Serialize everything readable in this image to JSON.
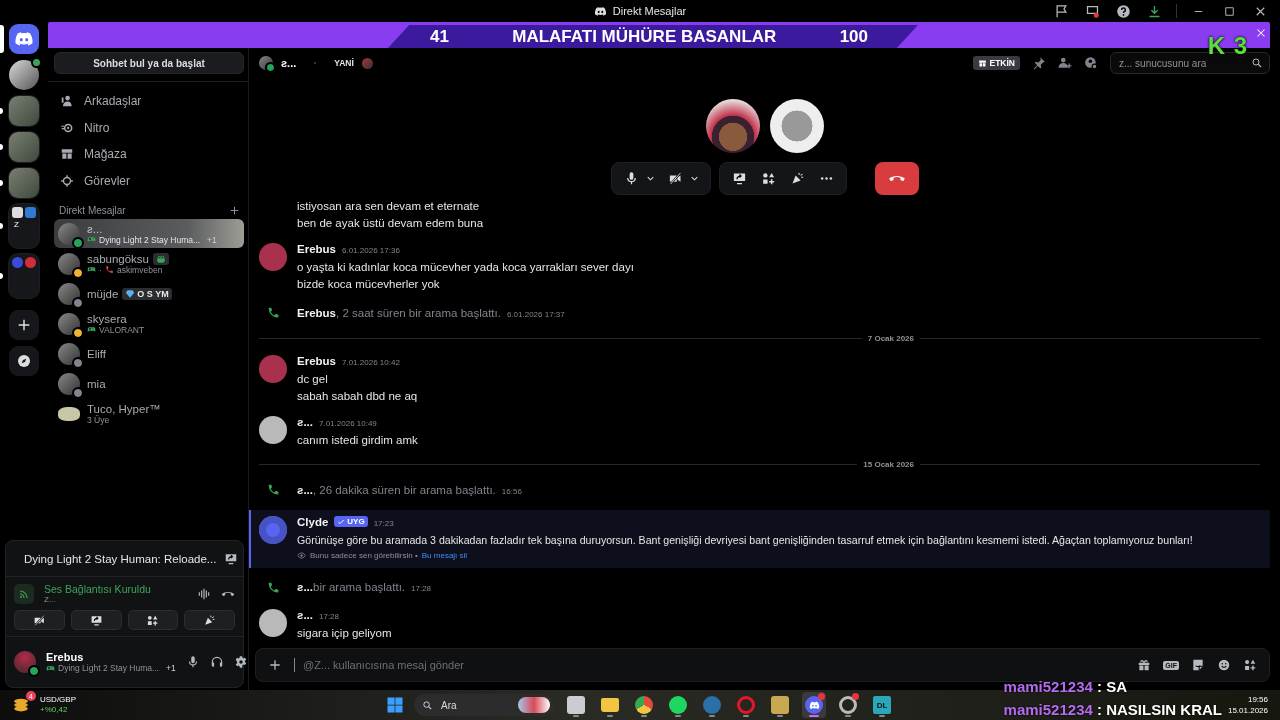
{
  "titlebar": {
    "title": "Direkt Mesajlar",
    "icons": [
      {
        "kind": "inbox"
      },
      {
        "kind": "screen_dot"
      },
      {
        "kind": "help"
      },
      {
        "kind": "download"
      }
    ]
  },
  "banner": {
    "overlay": {
      "left_score": "41",
      "title": "MALAFATI MÜHÜRE BASANLAR",
      "right_score": "100"
    },
    "logo": "K 3"
  },
  "server_rail": [
    {
      "kind": "home",
      "selected": true,
      "unread": false
    },
    {
      "kind": "voice_avatar",
      "selected": false,
      "unread": false
    },
    {
      "kind": "server",
      "selected": false,
      "unread": true
    },
    {
      "kind": "server",
      "selected": false,
      "unread": true
    },
    {
      "kind": "server",
      "selected": false,
      "unread": true
    },
    {
      "kind": "folder",
      "label": "Z",
      "selected": false,
      "unread": true
    },
    {
      "kind": "folder2",
      "selected": false,
      "unread": true
    },
    {
      "kind": "add",
      "selected": false,
      "unread": false
    },
    {
      "kind": "explore",
      "selected": false,
      "unread": false
    }
  ],
  "sidebar": {
    "search_button": "Sohbet bul ya da başlat",
    "nav": [
      {
        "kind": "friends",
        "label": "Arkadaşlar"
      },
      {
        "kind": "nitro",
        "label": "Nitro"
      },
      {
        "kind": "shop",
        "label": "Mağaza"
      },
      {
        "kind": "quests",
        "label": "Görevler"
      }
    ],
    "dm_header": "Direkt Mesajlar",
    "dms": [
      {
        "name": "ƨ...",
        "kind": "user",
        "color": "#23a55a",
        "selected": true,
        "activity": "Dying Light 2 Stay Huma...",
        "extra": "+1"
      },
      {
        "name": "sabungöksu",
        "kind": "user",
        "color": "#f0b232",
        "selected": false,
        "badge": {
          "kind": "frog"
        },
        "in_call": true,
        "separator": "·",
        "activity": "askimveben"
      },
      {
        "name": "müjde",
        "kind": "user",
        "color": "#80848e",
        "selected": false,
        "badge": {
          "kind": "gem",
          "text": "O S YM"
        }
      },
      {
        "name": "skysera",
        "kind": "user",
        "color": "#f0b232",
        "selected": false,
        "activity": "VALORANT"
      },
      {
        "name": "Eliff",
        "kind": "user",
        "color": "#80848e",
        "selected": false
      },
      {
        "name": "mia",
        "kind": "user",
        "color": "#80848e",
        "selected": false
      },
      {
        "name": "Tuco, Hyper™",
        "kind": "group",
        "selected": false,
        "subtitle": "3 Üye"
      }
    ]
  },
  "user_panel": {
    "activity_card": {
      "title": "Dying Light 2 Stay Human: Reloade..."
    },
    "voice": {
      "status": "Ses Bağlantısı Kuruldu",
      "channel": "Z...",
      "camera_off": true
    },
    "user": {
      "name": "Erebus",
      "color": "#23a55a",
      "activity": "Dying Light 2 Stay Huma...",
      "extra": "+1"
    }
  },
  "header": {
    "name": "ƨ...",
    "color": "#23a55a",
    "tag": "YANİ",
    "event_badge": "ETKİN",
    "search_placeholder": "z... sunucusunu ara"
  },
  "call": {
    "participants": [
      {
        "kind": "photo"
      },
      {
        "kind": "drawing"
      }
    ],
    "mic_muted": false,
    "camera_off": true
  },
  "messages": [
    {
      "kind": "continuation",
      "lines": [
        "istiyosan ara sen devam et eternate",
        "ben de ayak üstü devam edem buna"
      ]
    },
    {
      "kind": "message",
      "author": "Erebus",
      "color": "#a8324e",
      "time": "6.01.2026 17:36",
      "lines": [
        "o yaşta ki kadınlar koca mücevher yada koca yarrakları sever dayı",
        "bizde koca mücevherler yok"
      ]
    },
    {
      "kind": "call",
      "author": "Erebus",
      "text": ", 2 saat süren bir arama başlattı.",
      "time": "6.01.2026 17:37"
    },
    {
      "kind": "divider",
      "date": "7 Ocak 2026"
    },
    {
      "kind": "message",
      "author": "Erebus",
      "color": "#a8324e",
      "time": "7.01.2026 10:42",
      "lines": [
        "dc gel",
        "sabah sabah dbd ne aq"
      ]
    },
    {
      "kind": "message",
      "author": "ƨ...",
      "color": "#b9b9b9",
      "time": "7.01.2026 10:49",
      "lines": [
        "canım istedi girdim amk"
      ]
    },
    {
      "kind": "divider",
      "date": "15 Ocak 2026"
    },
    {
      "kind": "call",
      "author": "ƨ...",
      "text": ", 26 dakika süren bir arama başlattı.",
      "time": "16:56"
    },
    {
      "kind": "system",
      "author": "Clyde",
      "badge": "UYG",
      "time": "17:23",
      "text": "Görünüşe göre bu aramada 3 dakikadan fazladır tek başına duruyorsun. Bant genişliği devriyesi bant genişliğinden tasarruf etmek için bağlantını kesmemi istedi. Ağaçtan toplamıyoruz bunları!",
      "note": "Bunu sadece sen görebilirsin •",
      "link": "Bu mesajı sil"
    },
    {
      "kind": "call",
      "author": "ƨ...",
      "text": " bir arama başlattı.",
      "time": "17:28"
    },
    {
      "kind": "message",
      "author": "ƨ...",
      "color": "#b9b9b9",
      "time": "17:28",
      "lines": [
        "sigara içip geliyom"
      ]
    }
  ],
  "composer": {
    "placeholder": "@Z... kullanıcısına mesaj gönder",
    "gif": "GIF"
  },
  "taskbar": {
    "widget": {
      "badge": "4",
      "title": "USD/GBP",
      "change": "+%0,42"
    },
    "search_placeholder": "Ara",
    "apps": [
      {
        "kind": "taskview",
        "active": false,
        "notification": false
      },
      {
        "kind": "folder",
        "active": false,
        "notification": false
      },
      {
        "kind": "chrome",
        "active": false,
        "notification": false
      },
      {
        "kind": "spotify",
        "active": false,
        "notification": false
      },
      {
        "kind": "steam",
        "active": false,
        "notification": false
      },
      {
        "kind": "opera",
        "active": false,
        "notification": false
      },
      {
        "kind": "league",
        "active": false,
        "notification": false
      },
      {
        "kind": "discord",
        "active": true,
        "notification": true
      },
      {
        "kind": "obs",
        "active": false,
        "notification": true
      },
      {
        "kind": "dl",
        "label": "DL",
        "active": false,
        "notification": false
      }
    ],
    "time": "19:56",
    "date": "15.01.2026"
  },
  "stream_chat": [
    {
      "user": "mami521234",
      "text": ": SA"
    },
    {
      "user": "mami521234",
      "text": ": NASILSIN KRAL"
    }
  ]
}
